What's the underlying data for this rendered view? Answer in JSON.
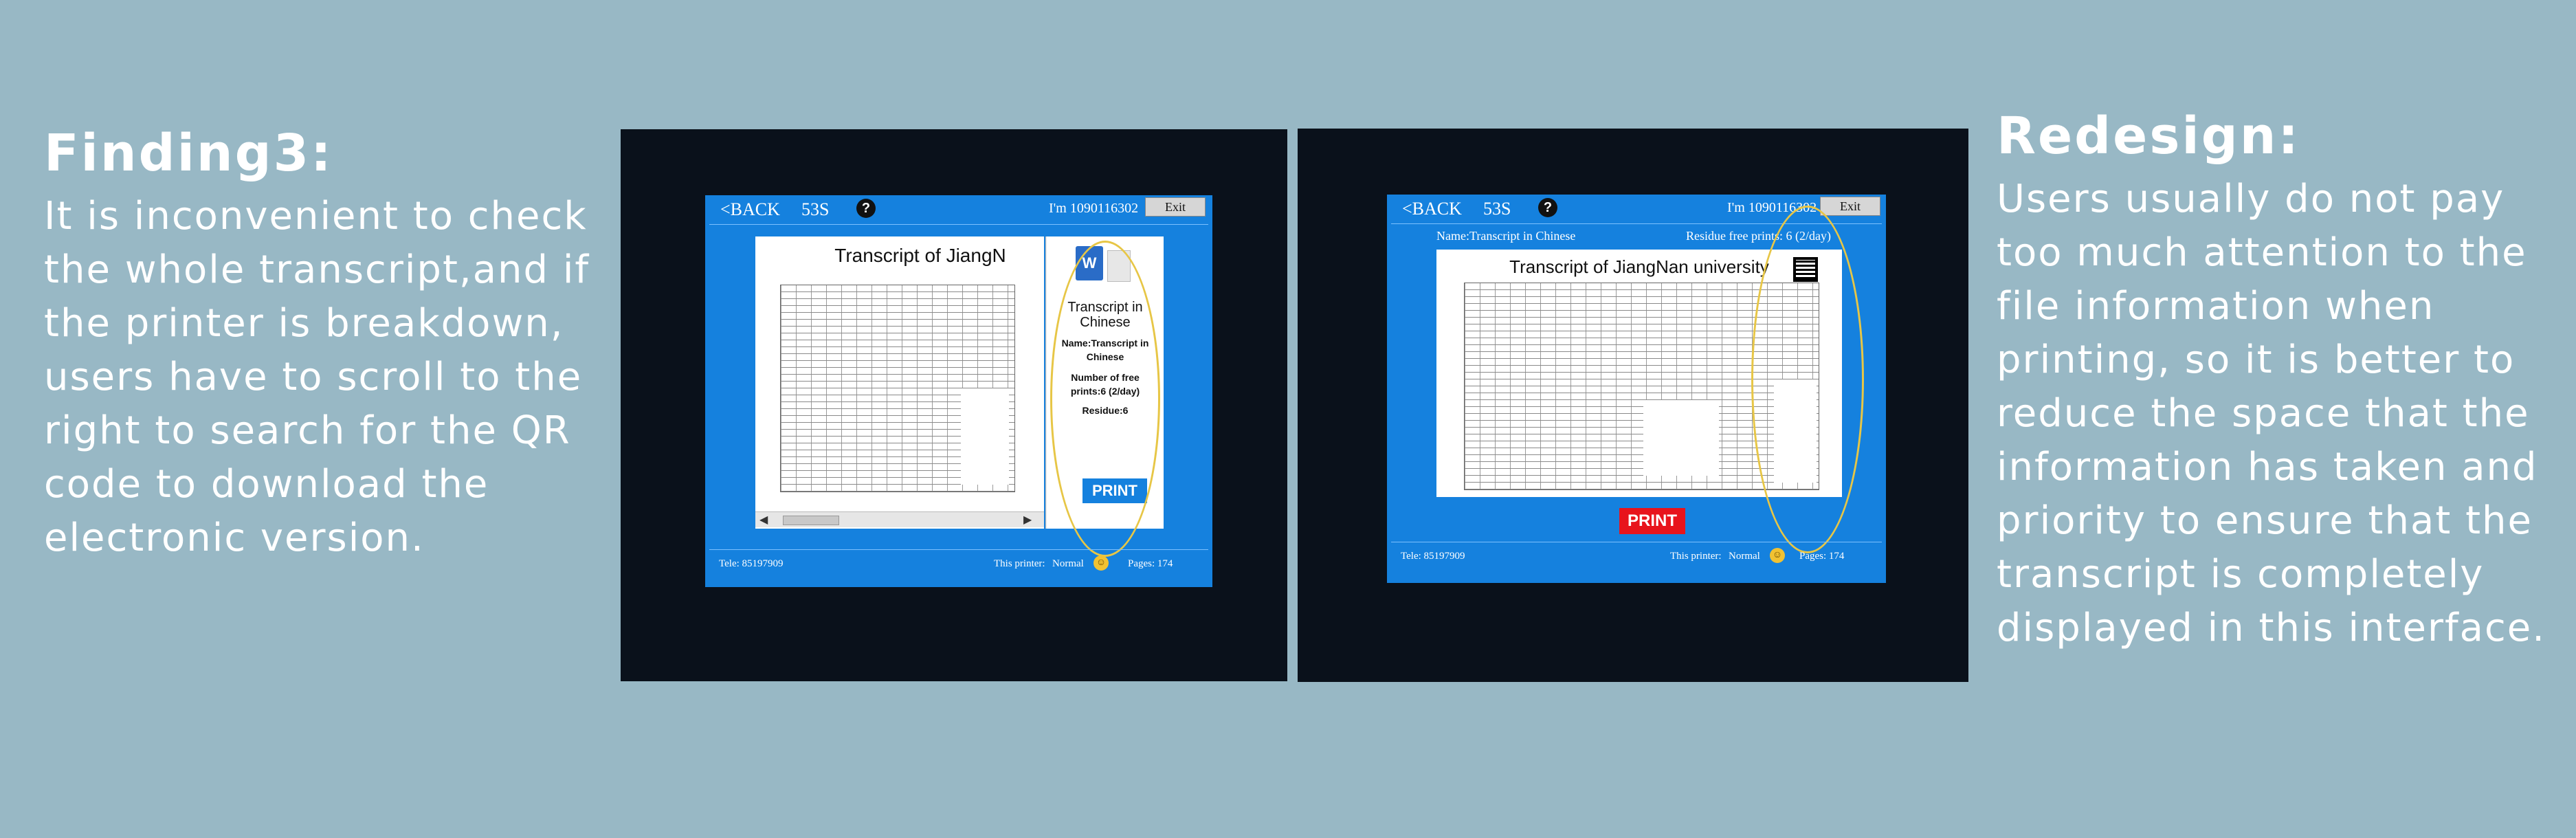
{
  "finding": {
    "title": "Finding3:",
    "text": "It is inconvenient to check the whole transcript,and if the printer is breakdown, users have to scroll to the right to search for the QR code to download the electronic version."
  },
  "redesign": {
    "title": "Redesign:",
    "text": "Users usually do not pay too much attention to the file information when printing, so it is better to reduce the space that the information has taken and priority to ensure that the transcript is completely displayed in this interface."
  },
  "kiosk_before": {
    "back_label": "<BACK",
    "countdown": "53S",
    "help_icon": "question-circle-icon",
    "user_label": "I'm 1090116302",
    "exit_label": "Exit",
    "doc_title": "Transcript of JiangN",
    "info": {
      "title": "Transcript in Chinese",
      "name": "Name:Transcript in Chinese",
      "free_prints": "Number of free prints:6 (2/day)",
      "residue": "Residue:6"
    },
    "print_label": "PRINT",
    "footer": {
      "tele": "Tele: 85197909",
      "printer_label": "This printer:",
      "printer_status": "Normal",
      "pages": "Pages: 174"
    }
  },
  "kiosk_after": {
    "back_label": "<BACK",
    "countdown": "53S",
    "help_icon": "question-circle-icon",
    "user_label": "I'm 1090116302",
    "exit_label": "Exit",
    "name_info": "Name:Transcript in Chinese",
    "residue_info": "Residue free prints: 6 (2/day)",
    "doc_title": "Transcript of JiangNan university",
    "print_label": "PRINT",
    "footer": {
      "tele": "Tele: 85197909",
      "printer_label": "This printer:",
      "printer_status": "Normal",
      "pages": "Pages: 174"
    }
  },
  "colors": {
    "background": "#98b8c5",
    "frame": "#0a111b",
    "kiosk_blue": "#1581de",
    "print_blue": "#1581de",
    "print_red": "#e8141c",
    "highlight_ellipse": "#e7c646"
  }
}
